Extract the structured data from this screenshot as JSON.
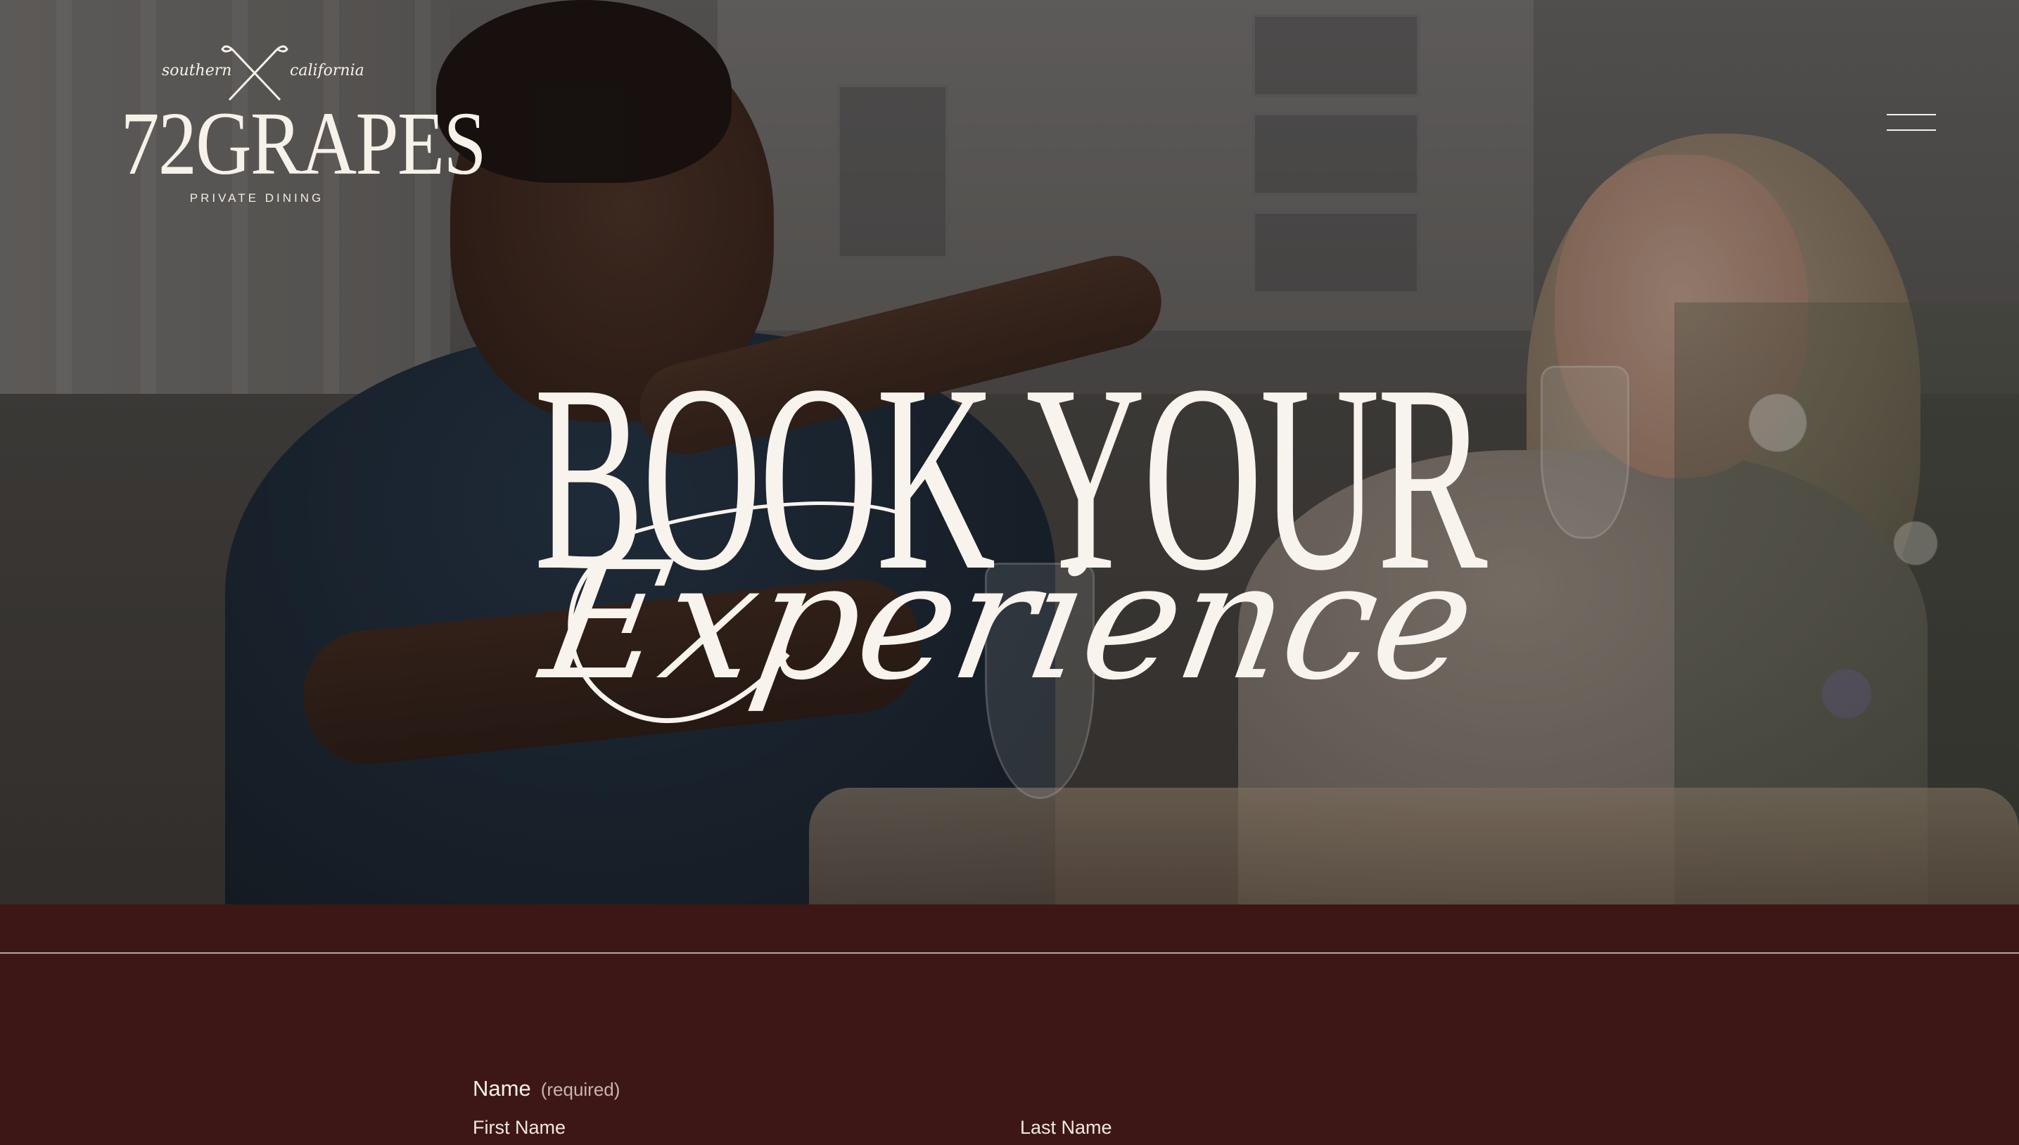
{
  "logo": {
    "tag_left": "southern",
    "tag_right": "california",
    "wordmark": "72GRAPES",
    "subtitle": "PRIVATE DINING"
  },
  "hero": {
    "title": "BOOK YOUR",
    "script": "Experience"
  },
  "form": {
    "name_label": "Name",
    "name_required": "(required)",
    "first_name_label": "First Name",
    "last_name_label": "Last Name"
  },
  "colors": {
    "section_bg": "#3d1716",
    "text_light": "#f6f1e9",
    "muted": "#c8b4ad"
  },
  "icons": [
    "golf-clubs-icon",
    "menu-icon"
  ]
}
